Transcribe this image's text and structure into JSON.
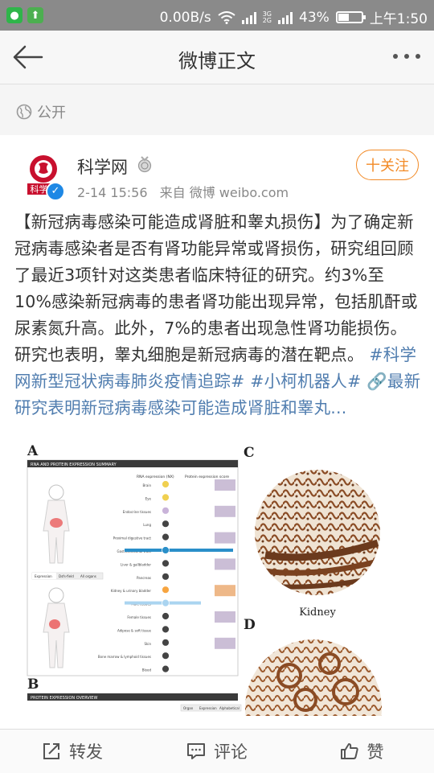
{
  "status_bar": {
    "network_speed": "0.00B/s",
    "network_label_3g": "3G",
    "network_label_2g": "2G",
    "battery": "43%",
    "time": "上午1:50"
  },
  "nav": {
    "title": "微博正文"
  },
  "visibility": {
    "label": "公开"
  },
  "post": {
    "author": "科学网",
    "time": "2-14 15:56",
    "source": "来自 微博 weibo.com",
    "follow_label": "十关注",
    "avatar_text": "科学网",
    "text_main": "【新冠病毒感染可能造成肾脏和睾丸损伤】为了确定新冠病毒感染者是否有肾功能异常或肾损伤，研究组回顾了最近3项针对这类患者临床特征的研究。约3%至10%感染新冠病毒的患者肾功能出现异常，包括肌酐或尿素氮升高。此外，7%的患者出现急性肾功能损伤。研究也表明，睾丸细胞是新冠病毒的潜在靶点。",
    "tag1": "#科学网新型冠状病毒肺炎疫情追踪#",
    "tag2": "#小柯机器人#",
    "link": "🔗最新研究表明新冠病毒感染可能造成肾脏和睾丸...",
    "figure": {
      "panel_a": "A",
      "panel_b": "B",
      "panel_c": "C",
      "panel_d": "D",
      "kidney_label": "Kidney",
      "header_a": "RNA AND PROTEIN EXPRESSION SUMMARY",
      "header_b": "PROTEIN EXPRESSION OVERVIEW",
      "col_rna": "RNA expression (NX)",
      "col_protein": "Protein expression score",
      "tissues": [
        "Brain",
        "Eye",
        "Endocrine tissues",
        "Lung",
        "Proximal digestive tract",
        "Gastrointestinal tract",
        "Liver & gallbladder",
        "Pancreas",
        "Kidney & urinary bladder",
        "Male tissues",
        "Female tissues",
        "Adipose & soft tissue",
        "Skin",
        "Bone marrow & lymphoid tissues",
        "Blood"
      ],
      "tabs_a": [
        "Expression",
        "Dsfs-field",
        "All organs"
      ],
      "tabs_b": [
        "Organ",
        "Expression",
        "Alphabetical"
      ]
    }
  },
  "actions": {
    "repost": "转发",
    "comment": "评论",
    "like": "赞"
  }
}
